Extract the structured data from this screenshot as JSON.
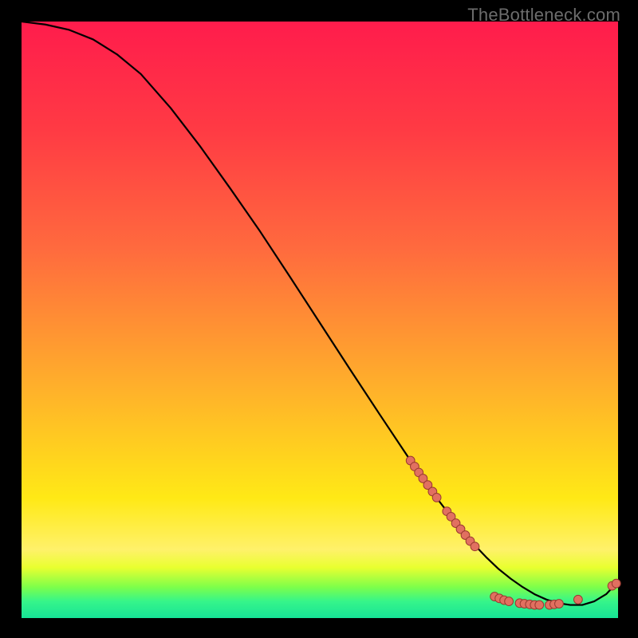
{
  "watermark": "TheBottleneck.com",
  "colors": {
    "line": "#000000",
    "marker_fill": "#e17060",
    "marker_stroke": "#9a3a30"
  },
  "chart_data": {
    "type": "line",
    "title": "",
    "xlabel": "",
    "ylabel": "",
    "xlim": [
      0,
      100
    ],
    "ylim": [
      0,
      100
    ],
    "grid": false,
    "legend": false,
    "series": [
      {
        "name": "curve",
        "x": [
          0,
          4,
          8,
          12,
          16,
          20,
          25,
          30,
          35,
          40,
          45,
          50,
          55,
          60,
          65,
          70,
          73,
          76,
          78,
          80,
          82,
          84,
          86,
          88,
          90,
          92,
          94,
          96,
          98,
          100
        ],
        "y": [
          100,
          99.5,
          98.6,
          97.0,
          94.5,
          91.2,
          85.5,
          79.0,
          72.0,
          64.8,
          57.2,
          49.5,
          41.8,
          34.2,
          26.7,
          19.6,
          15.7,
          12.2,
          10.1,
          8.2,
          6.6,
          5.2,
          4.0,
          3.1,
          2.5,
          2.2,
          2.2,
          2.8,
          4.0,
          6.1
        ]
      }
    ],
    "markers": [
      {
        "x": 65.2,
        "y": 26.4
      },
      {
        "x": 65.9,
        "y": 25.4
      },
      {
        "x": 66.6,
        "y": 24.4
      },
      {
        "x": 67.3,
        "y": 23.4
      },
      {
        "x": 68.1,
        "y": 22.3
      },
      {
        "x": 68.9,
        "y": 21.2
      },
      {
        "x": 69.6,
        "y": 20.2
      },
      {
        "x": 71.3,
        "y": 17.9
      },
      {
        "x": 72.0,
        "y": 17.0
      },
      {
        "x": 72.8,
        "y": 15.9
      },
      {
        "x": 73.6,
        "y": 14.9
      },
      {
        "x": 74.4,
        "y": 13.9
      },
      {
        "x": 75.2,
        "y": 12.9
      },
      {
        "x": 76.0,
        "y": 12.0
      },
      {
        "x": 79.3,
        "y": 3.6
      },
      {
        "x": 80.1,
        "y": 3.3
      },
      {
        "x": 80.9,
        "y": 3.0
      },
      {
        "x": 81.7,
        "y": 2.8
      },
      {
        "x": 83.5,
        "y": 2.5
      },
      {
        "x": 84.3,
        "y": 2.4
      },
      {
        "x": 85.2,
        "y": 2.3
      },
      {
        "x": 86.0,
        "y": 2.2
      },
      {
        "x": 86.8,
        "y": 2.2
      },
      {
        "x": 88.5,
        "y": 2.2
      },
      {
        "x": 89.3,
        "y": 2.3
      },
      {
        "x": 90.1,
        "y": 2.4
      },
      {
        "x": 93.3,
        "y": 3.1
      },
      {
        "x": 99.0,
        "y": 5.4
      },
      {
        "x": 99.7,
        "y": 5.8
      }
    ]
  }
}
